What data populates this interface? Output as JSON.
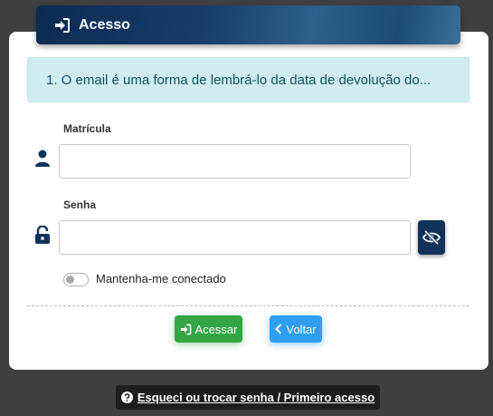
{
  "header": {
    "title": "Acesso",
    "icon": "sign-in-icon"
  },
  "alert": {
    "text": "1. O email é uma forma de lembrá-lo da data de devolução do..."
  },
  "matricula": {
    "label": "Matrícula",
    "value": "",
    "icon": "user-icon"
  },
  "senha": {
    "label": "Senha",
    "value": "",
    "icon": "unlock-icon",
    "toggle_icon": "eye-slash-icon"
  },
  "remember": {
    "label": "Mantenha-me conectado",
    "checked": false
  },
  "buttons": {
    "enter_label": "Acessar",
    "back_label": "Voltar"
  },
  "footer": {
    "forgot_label": "Esqueci ou trocar senha / Primeiro acesso"
  },
  "colors": {
    "primary": "#10325a",
    "success": "#33a544",
    "info": "#2e9ef3",
    "alert_bg": "#d1ecf1",
    "alert_text": "#0c5460"
  }
}
